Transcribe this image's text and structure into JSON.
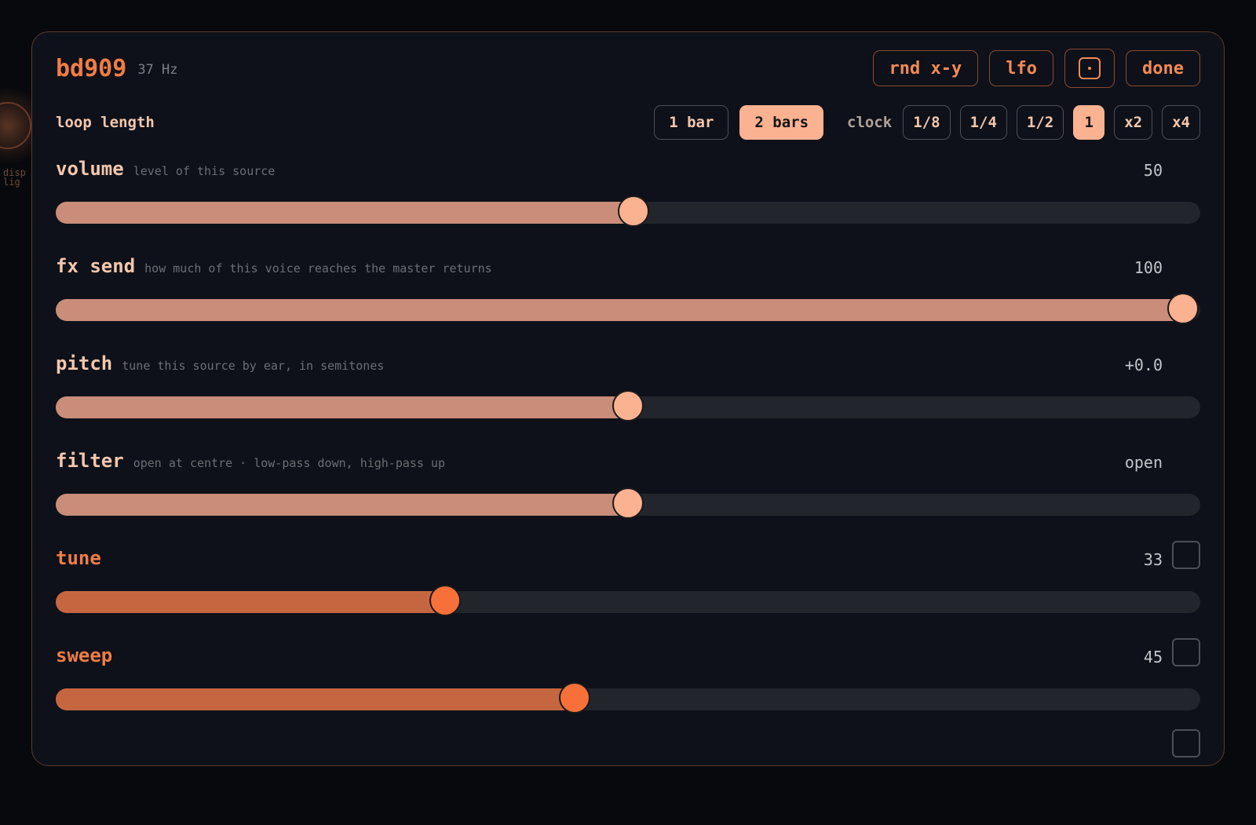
{
  "header": {
    "title": "bd909",
    "subtitle": "37 Hz",
    "rnd_label": "rnd x-y",
    "lfo_label": "lfo",
    "done_label": "done",
    "dice_icon": "dice-icon"
  },
  "loop": {
    "label": "loop length",
    "bars": [
      {
        "label": "1 bar",
        "active": false
      },
      {
        "label": "2 bars",
        "active": true
      }
    ],
    "clock_label": "clock",
    "clock_options": [
      {
        "label": "1/8",
        "active": false
      },
      {
        "label": "1/4",
        "active": false
      },
      {
        "label": "1/2",
        "active": false
      },
      {
        "label": "1",
        "active": true
      },
      {
        "label": "x2",
        "active": false
      },
      {
        "label": "x4",
        "active": false
      }
    ]
  },
  "params": [
    {
      "name": "volume",
      "desc": "level of this source",
      "value": "50",
      "level": 0.505,
      "accent": false,
      "checkbox": false
    },
    {
      "name": "fx send",
      "desc": "how much of this voice reaches the master returns",
      "value": "100",
      "level": 1.0,
      "accent": false,
      "checkbox": false
    },
    {
      "name": "pitch",
      "desc": "tune this source by ear, in semitones",
      "value": "+0.0",
      "level": 0.5,
      "accent": false,
      "checkbox": false
    },
    {
      "name": "filter",
      "desc": "open at centre · low-pass down, high-pass up",
      "value": "open",
      "level": 0.5,
      "accent": false,
      "checkbox": false
    },
    {
      "name": "tune",
      "desc": "",
      "value": "33",
      "level": 0.335,
      "accent": true,
      "checkbox": true
    },
    {
      "name": "sweep",
      "desc": "",
      "value": "45",
      "level": 0.452,
      "accent": true,
      "checkbox": true
    }
  ],
  "colors": {
    "accent": "#f07d45",
    "active_fill": "#fbb291",
    "panel_bg": "#0e1119"
  }
}
